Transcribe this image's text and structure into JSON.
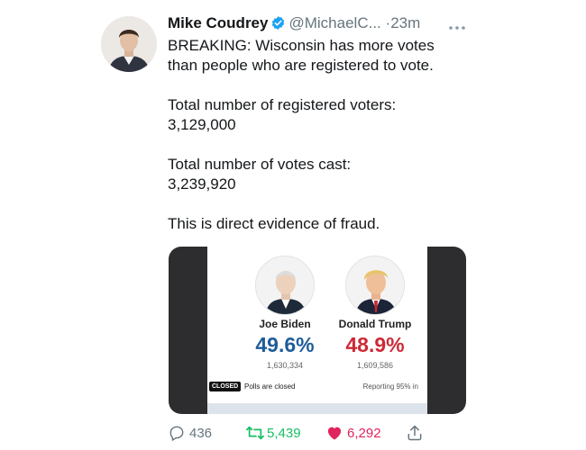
{
  "tweet": {
    "display_name": "Mike Coudrey",
    "handle": "@MichaelC...",
    "separator": "·",
    "time": "23m",
    "lines": [
      "BREAKING: Wisconsin has more votes",
      "than people who are registered to vote.",
      "",
      "Total number of registered voters:",
      "3,129,000",
      "",
      "Total number of votes cast:",
      "3,239,920",
      "",
      "This is direct evidence of fraud."
    ]
  },
  "card": {
    "candidates": [
      {
        "name": "Joe Biden",
        "percent": "49.6%",
        "votes": "1,630,334",
        "color": "#1f5c99"
      },
      {
        "name": "Donald Trump",
        "percent": "48.9%",
        "votes": "1,609,586",
        "color": "#cc2a36"
      }
    ],
    "status_badge": "CLOSED",
    "status_text": "Polls are closed",
    "reporting": "Reporting 95% in"
  },
  "actions": {
    "replies": "436",
    "retweets": "5,439",
    "likes": "6,292",
    "colors": {
      "reply": "#66757f",
      "retweet": "#17bf63",
      "like": "#e0245e",
      "share": "#66757f"
    }
  },
  "colors": {
    "verified": "#1da1f2",
    "text": "#14171a",
    "muted": "#66757f"
  }
}
